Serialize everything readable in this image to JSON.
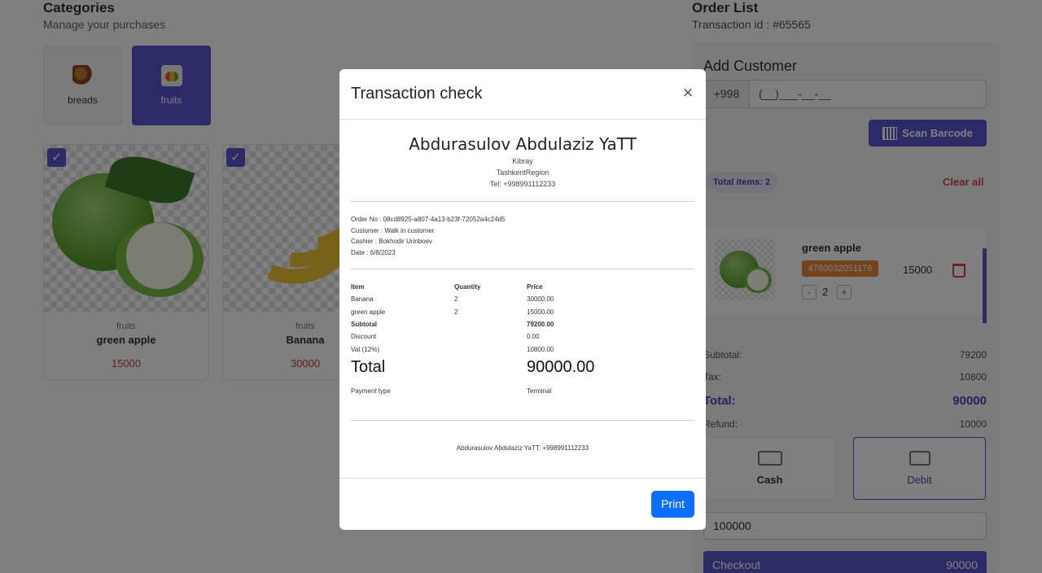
{
  "categories": {
    "title": "Categories",
    "subtitle": "Manage your purchases",
    "items": [
      {
        "label": "breads",
        "icon": "bread-icon"
      },
      {
        "label": "fruits",
        "icon": "fruits-icon"
      }
    ]
  },
  "products": [
    {
      "category": "fruits",
      "name": "green apple",
      "price": "15000"
    },
    {
      "category": "fruits",
      "name": "Banana",
      "price": "30000"
    }
  ],
  "order": {
    "title": "Order List",
    "transaction": "Transaction id : #65565",
    "add_customer": "Add Customer",
    "phone_prefix": "+998",
    "phone_placeholder": "(__)___-__-__",
    "scan_label": "Scan Barcode",
    "total_items": "Total items: 2",
    "clear_all": "Clear all",
    "cart": [
      {
        "name": "green apple",
        "barcode": "4780032051176",
        "qty": "2",
        "price": "15000",
        "minus": "-",
        "plus": "+"
      }
    ],
    "summary": {
      "subtotal_label": "Subtotal:",
      "subtotal": "79200",
      "tax_label": "Tax:",
      "tax": "10800",
      "total_label": "Total:",
      "total": "90000",
      "refund_label": "Refund:",
      "refund": "10000"
    },
    "payment": {
      "cash": "Cash",
      "debit": "Debit"
    },
    "amount": "100000",
    "checkout_label": "Checkout",
    "checkout_amount": "90000"
  },
  "modal": {
    "title": "Transaction check",
    "close": "×",
    "store_name": "Abdurasulov Abdulaziz YaTT",
    "store_lines": [
      "Kibray",
      "TashkentRegion",
      "Tel: +998991112233"
    ],
    "meta": [
      "Order No : 08cd8925-a807-4a13-b23f-72052a4c24d5",
      "Customer : Walk in customer",
      "Cashier : Bokhodir Urinboev",
      "Date : 6/8/2023"
    ],
    "table_headers": {
      "item": "Item",
      "quantity": "Quantity",
      "price": "Price"
    },
    "rows": [
      {
        "item": "Banana",
        "quantity": "2",
        "price": "30000.00"
      },
      {
        "item": "green apple",
        "quantity": "2",
        "price": "15000.00"
      }
    ],
    "subtotal_label": "Subtotal",
    "subtotal": "79200.00",
    "discount_label": "Discount",
    "discount": "0.00",
    "vat_label": "Vat (12%)",
    "vat": "10800.00",
    "total_label": "Total",
    "total": "90000.00",
    "payment_type_label": "Payment type",
    "payment_type": "Terminal",
    "footer": "Abdurasulov Abdulaziz YaTT: +998991112233",
    "print_label": "Print"
  },
  "colors": {
    "accent": "#5b54d0",
    "price_red": "#c84040",
    "print_blue": "#0d6efd",
    "barcode_orange": "#e8873a"
  }
}
